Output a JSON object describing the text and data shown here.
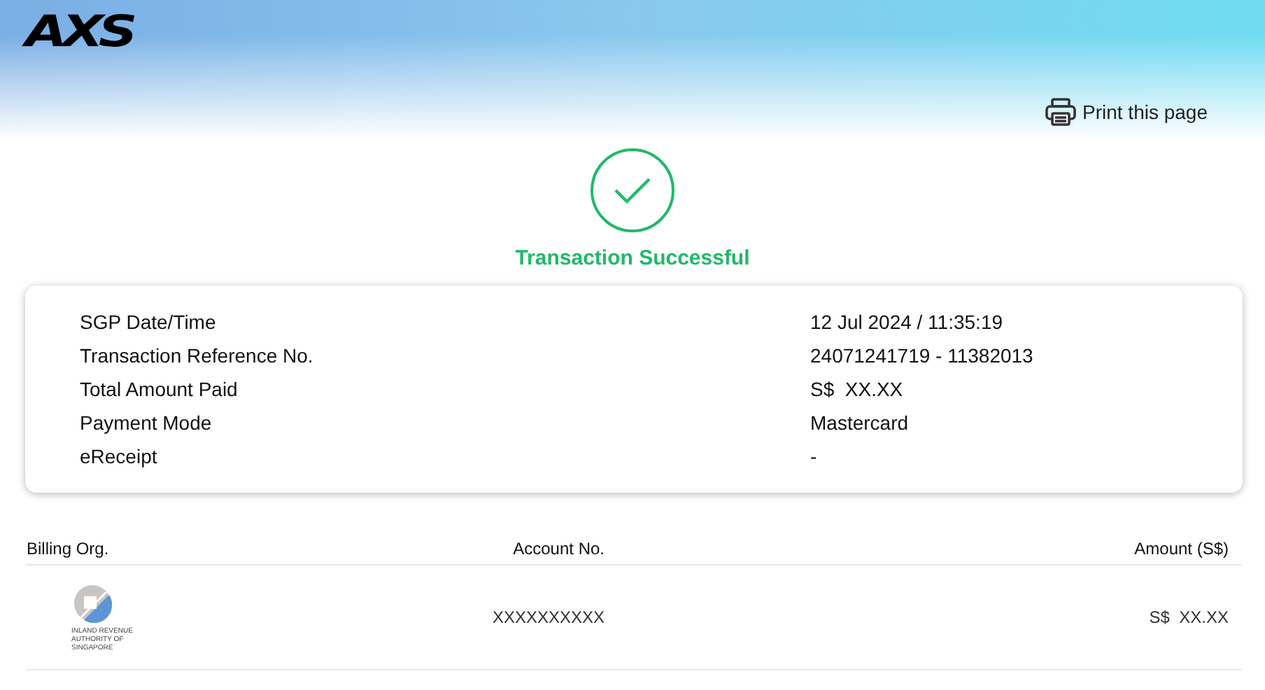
{
  "header": {
    "logo": "AXS",
    "print_link": "Print this page"
  },
  "status": {
    "title": "Transaction Successful"
  },
  "details": [
    {
      "label": "SGP Date/Time",
      "value": "12 Jul 2024 / 11:35:19"
    },
    {
      "label": "Transaction Reference No.",
      "value": "24071241719 - 11382013"
    },
    {
      "label": "Total Amount Paid",
      "value": "S$  XX.XX"
    },
    {
      "label": "Payment Mode",
      "value": "Mastercard"
    },
    {
      "label": "eReceipt",
      "value": "-"
    }
  ],
  "table": {
    "columns": [
      "Billing Org.",
      "Account No.",
      "Amount (S$)"
    ],
    "rows": [
      {
        "org_logo_text": [
          "INLAND REVENUE",
          "AUTHORITY OF",
          "SINGAPORE"
        ],
        "account": "XXXXXXXXXX",
        "amount": "S$  XX.XX"
      }
    ]
  }
}
